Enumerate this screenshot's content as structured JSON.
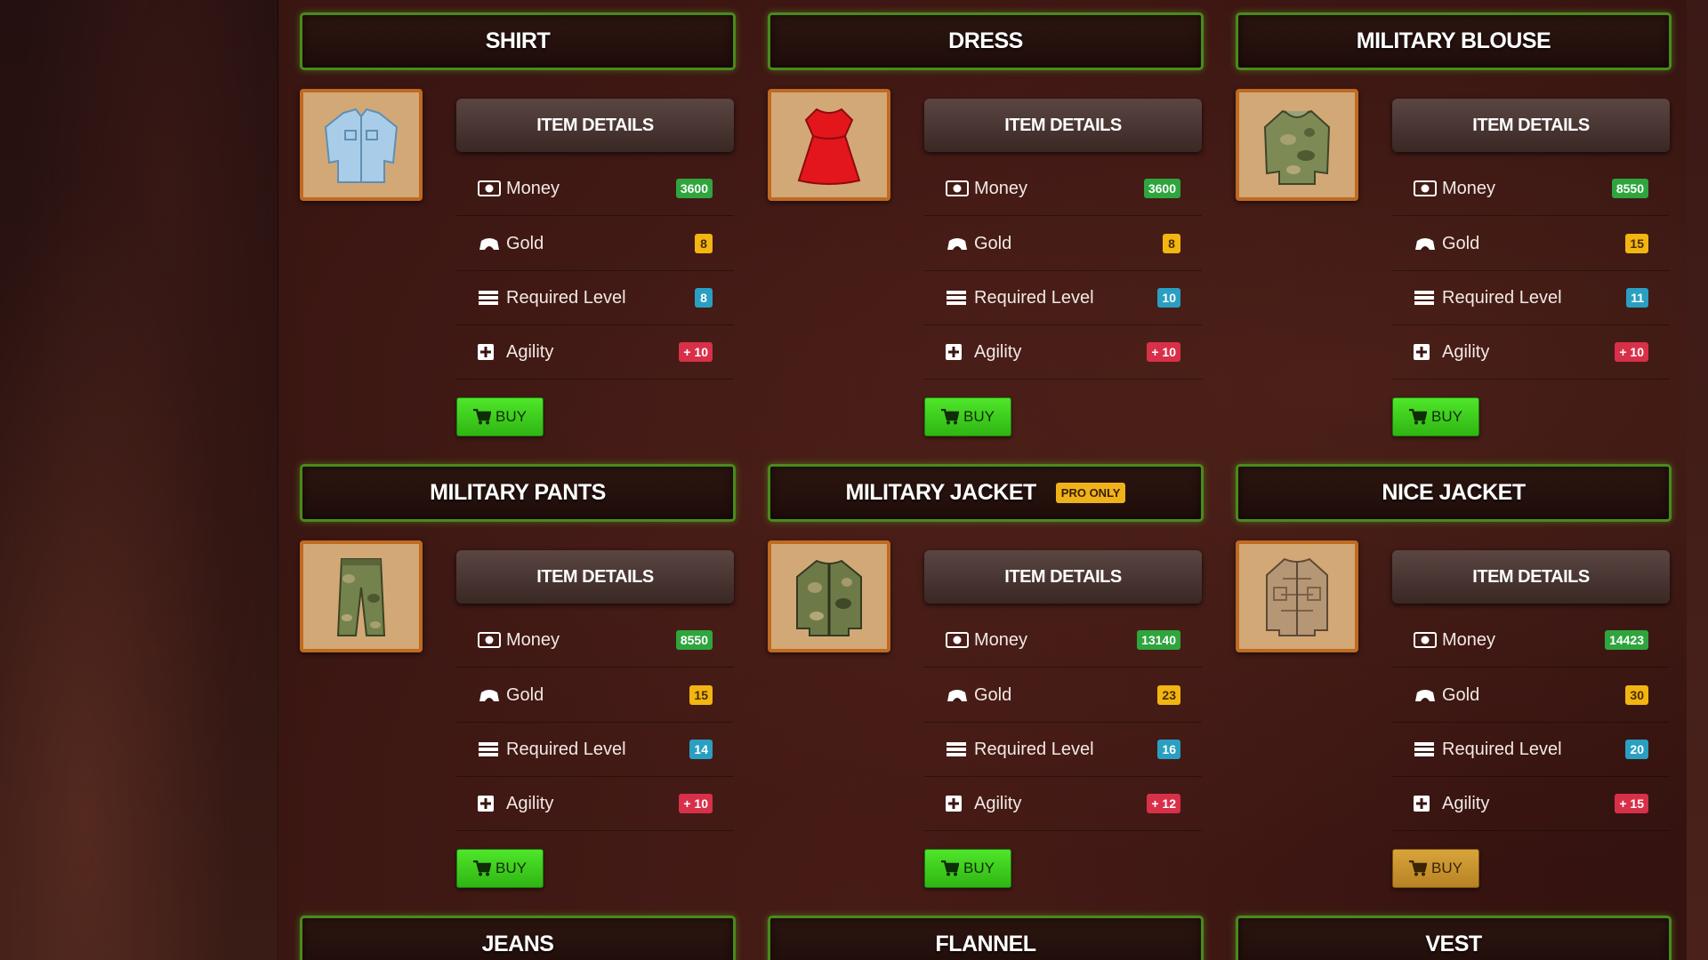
{
  "labels": {
    "item_details": "ITEM DETAILS",
    "money": "Money",
    "gold": "Gold",
    "required_level": "Required Level",
    "agility": "Agility",
    "buy": "BUY"
  },
  "colors": {
    "frame_green": "#4a8a1c",
    "thumb_border": "#c06a22",
    "money_pill": "#2fa53e",
    "gold_pill": "#f2b511",
    "level_pill": "#2a9fc2",
    "agility_pill": "#d9304a",
    "buy_green": "#3fd41f",
    "buy_disabled": "#c99130"
  },
  "items": [
    {
      "title": "SHIRT",
      "badge": "",
      "money": "3600",
      "gold": "8",
      "level": "8",
      "agility": "+ 10",
      "buy_enabled": true,
      "icon": "shirt-icon"
    },
    {
      "title": "DRESS",
      "badge": "",
      "money": "3600",
      "gold": "8",
      "level": "10",
      "agility": "+ 10",
      "buy_enabled": true,
      "icon": "dress-icon"
    },
    {
      "title": "MILITARY BLOUSE",
      "badge": "",
      "money": "8550",
      "gold": "15",
      "level": "11",
      "agility": "+ 10",
      "buy_enabled": true,
      "icon": "military-blouse-icon"
    },
    {
      "title": "MILITARY PANTS",
      "badge": "",
      "money": "8550",
      "gold": "15",
      "level": "14",
      "agility": "+ 10",
      "buy_enabled": true,
      "icon": "military-pants-icon"
    },
    {
      "title": "MILITARY JACKET",
      "badge": "PRO ONLY",
      "money": "13140",
      "gold": "23",
      "level": "16",
      "agility": "+ 12",
      "buy_enabled": true,
      "icon": "military-jacket-icon"
    },
    {
      "title": "NICE JACKET",
      "badge": "",
      "money": "14423",
      "gold": "30",
      "level": "20",
      "agility": "+ 15",
      "buy_enabled": false,
      "icon": "nice-jacket-icon"
    },
    {
      "title": "JEANS"
    },
    {
      "title": "FLANNEL"
    },
    {
      "title": "VEST"
    }
  ]
}
